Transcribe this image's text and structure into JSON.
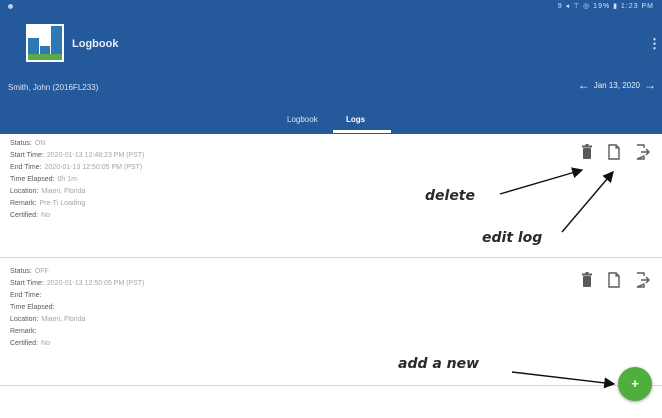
{
  "header": {
    "app_title": "Logbook",
    "menu_icon": "more-vert-icon",
    "driver": "Smith, John (2016FL233)",
    "date": "Jan 13, 2020",
    "date_prev_icon": "arrow-left-icon",
    "date_next_icon": "arrow-right-icon",
    "background_color": "#245a9c",
    "status_icons": "9 ◂ ⊤ ◎ 19% ▮ 1:23 PM"
  },
  "tabs": [
    {
      "label": "Logbook",
      "selected": false
    },
    {
      "label": "Logs",
      "selected": true
    }
  ],
  "logs": [
    {
      "status_label": "Status:",
      "status": "ON",
      "start_label": "Start Time:",
      "start": "2020-01-13 12:48:23 PM (PST)",
      "end_label": "End Time:",
      "end": "2020-01-13 12:50:05 PM (PST)",
      "elapsed_label": "Time Elapsed:",
      "elapsed": "0h 1m",
      "location_label": "Location:",
      "location": "Miami, Florida",
      "remark_label": "Remark:",
      "remark": "Pre-Ti Loading",
      "certified_label": "Certified:",
      "certified": "No"
    },
    {
      "status_label": "Status:",
      "status": "OFF",
      "start_label": "Start Time:",
      "start": "2020-01-13 12:50:05 PM (PST)",
      "end_label": "End Time:",
      "end": "",
      "elapsed_label": "Time Elapsed:",
      "elapsed": "",
      "location_label": "Location:",
      "location": "Miami, Florida",
      "remark_label": "Remark:",
      "remark": "",
      "certified_label": "Certified:",
      "certified": "No"
    }
  ],
  "card_actions": [
    "delete-icon",
    "edit-log-icon",
    "export-icon"
  ],
  "fab": {
    "label": "+",
    "color": "#4fae3e",
    "icon": "add-icon"
  },
  "annotations": {
    "delete": "delete",
    "edit": "edit log",
    "add": "add a new"
  }
}
